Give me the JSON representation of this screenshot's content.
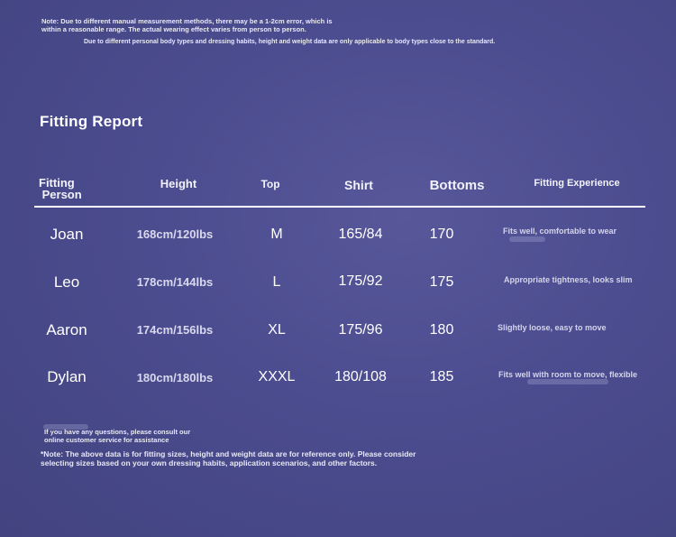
{
  "notes": {
    "top_line": "Note: Due to different manual measurement methods, there may be a 1-2cm error, which is\n within a reasonable range. The actual wearing effect varies from person to person.",
    "top_line2": "Due to different personal body types and dressing habits, height and weight data are only applicable to body types close to the standard.",
    "bottom_contact": "If you have any questions, please consult our\n  online customer service for assistance",
    "bottom_disclaimer": "*Note: The above data is for fitting sizes, height and weight data are for reference only. Please consider\n selecting sizes based on your own dressing habits, application scenarios, and other factors."
  },
  "report": {
    "title": "Fitting Report",
    "headers": {
      "person_line1": "Fitting",
      "person_line2": " Person",
      "height": "Height",
      "top": "Top",
      "shirt": "Shirt",
      "bottoms": "Bottoms",
      "experience": "Fitting Experience"
    },
    "rows": [
      {
        "name": "Joan",
        "height": "168cm/120lbs",
        "top": "M",
        "shirt": "165/84",
        "bottoms": "170",
        "experience": "Fits well, comfortable to wear"
      },
      {
        "name": "Leo",
        "height": "178cm/144lbs",
        "top": "L",
        "shirt": "175/92",
        "bottoms": "175",
        "experience": "Appropriate tightness, looks slim"
      },
      {
        "name": "Aaron",
        "height": "174cm/156lbs",
        "top": "XL",
        "shirt": "175/96",
        "bottoms": "180",
        "experience": "Slightly loose, easy to move"
      },
      {
        "name": "Dylan",
        "height": "180cm/180lbs",
        "top": "XXXL",
        "shirt": "180/108",
        "bottoms": "185",
        "experience": "Fits well with room to move, flexible"
      }
    ]
  },
  "colors": {
    "background": "#4b4c8f",
    "text": "#ffffff",
    "muted_text": "#d9d9ee"
  }
}
